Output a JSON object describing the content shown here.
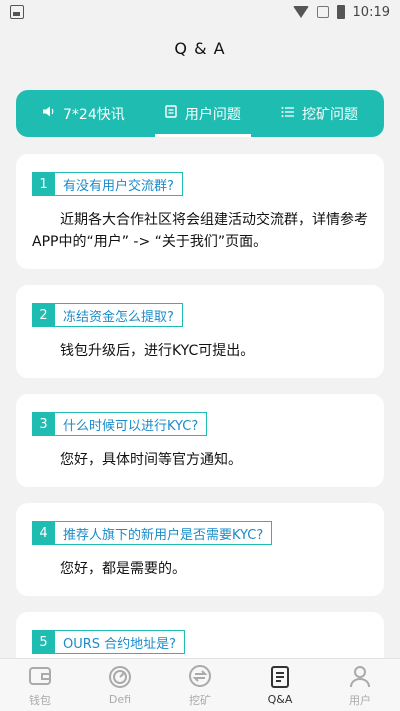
{
  "status": {
    "time": "10:19"
  },
  "header": {
    "title": "Q & A"
  },
  "tabs": [
    {
      "label": "7*24快讯",
      "icon": "speaker-icon"
    },
    {
      "label": "用户问题",
      "icon": "document-icon"
    },
    {
      "label": "挖矿问题",
      "icon": "list-icon"
    }
  ],
  "faq": [
    {
      "num": "1",
      "question": "有没有用户交流群?",
      "answer": "近期各大合作社区将会组建活动交流群，详情参考APP中的“用户” -> “关于我们”页面。"
    },
    {
      "num": "2",
      "question": "冻结资金怎么提取?",
      "answer": "钱包升级后，进行KYC可提出。"
    },
    {
      "num": "3",
      "question": "什么时候可以进行KYC?",
      "answer": "您好，具体时间等官方通知。"
    },
    {
      "num": "4",
      "question": "推荐人旗下的新用户是否需要KYC?",
      "answer": "您好，都是需要的。"
    },
    {
      "num": "5",
      "question": "OURS 合约地址是?",
      "answer": ""
    }
  ],
  "nav": [
    {
      "label": "钱包",
      "icon": "wallet-icon"
    },
    {
      "label": "Defi",
      "icon": "defi-icon"
    },
    {
      "label": "挖矿",
      "icon": "mining-icon"
    },
    {
      "label": "Q&A",
      "icon": "qa-icon"
    },
    {
      "label": "用户",
      "icon": "user-icon"
    }
  ],
  "colors": {
    "accent": "#1ebcb1",
    "question_text": "#1a8cc9"
  }
}
